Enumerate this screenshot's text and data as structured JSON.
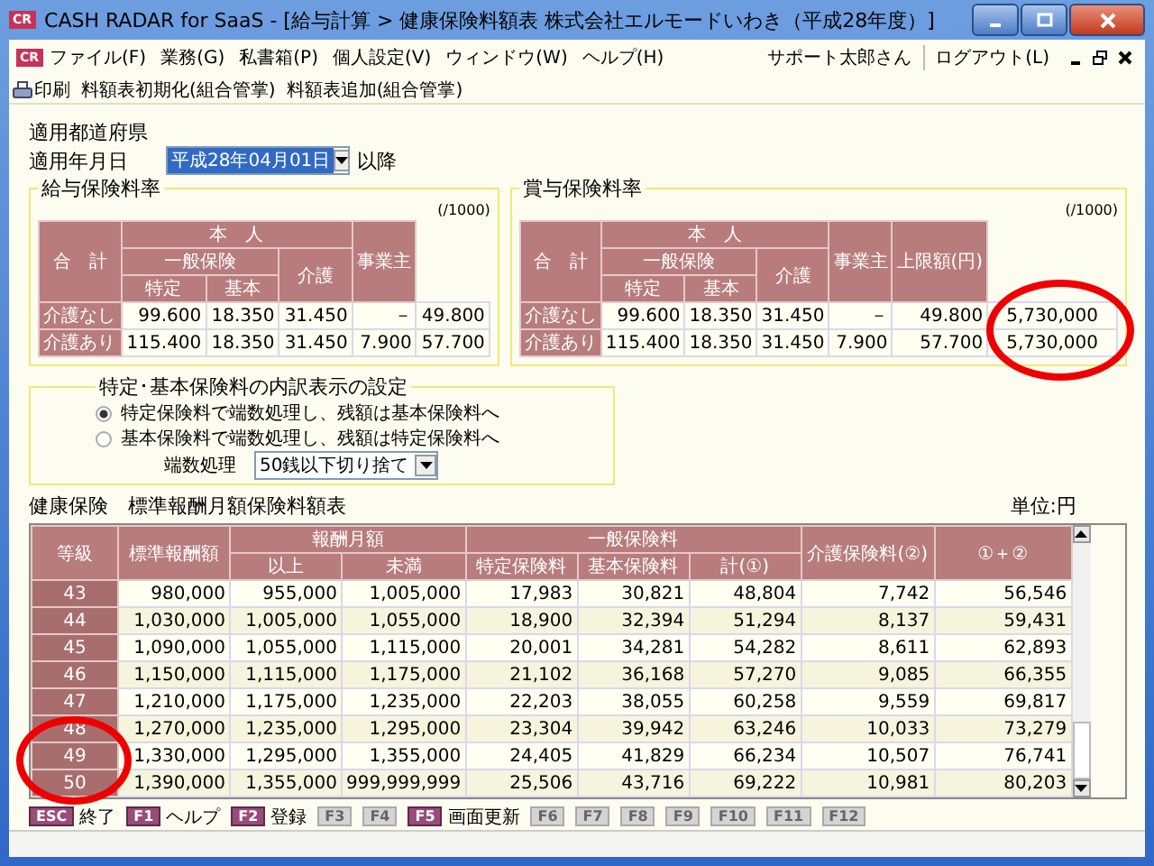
{
  "window": {
    "title": "CASH RADAR for SaaS - [給与計算 > 健康保険料額表 株式会社エルモードいわき（平成28年度）]",
    "app_badge": "CR"
  },
  "menu": {
    "badge": "CR",
    "items": [
      "ファイル(F)",
      "業務(G)",
      "私書箱(P)",
      "個人設定(V)",
      "ウィンドウ(W)",
      "ヘルプ(H)"
    ],
    "user": "サポート太郎さん",
    "logout": "ログアウト(L)"
  },
  "toolbar": {
    "items": [
      "印刷",
      "料額表初期化(組合管掌)",
      "料額表追加(組合管掌)"
    ]
  },
  "prefecture_label": "適用都道府県",
  "date": {
    "label": "適用年月日",
    "value": "平成28年04月01日",
    "suffix": "以降",
    "focused": true
  },
  "salary_rates": {
    "title": "給与保険料率",
    "unit": "(/1000)",
    "headers": {
      "total": "合　計",
      "person": "本　人",
      "general": "一般保険",
      "specific": "特定",
      "basic": "基本",
      "care": "介護",
      "employer": "事業主"
    },
    "rows": [
      {
        "label": "介護なし",
        "values": [
          "99.600",
          "18.350",
          "31.450",
          "－",
          "49.800"
        ]
      },
      {
        "label": "介護あり",
        "values": [
          "115.400",
          "18.350",
          "31.450",
          "7.900",
          "57.700"
        ]
      }
    ]
  },
  "bonus_rates": {
    "title": "賞与保険料率",
    "unit": "(/1000)",
    "headers": {
      "total": "合　計",
      "person": "本　人",
      "general": "一般保険",
      "specific": "特定",
      "basic": "基本",
      "care": "介護",
      "employer": "事業主",
      "limit": "上限額(円)"
    },
    "limit_circled": true,
    "rows": [
      {
        "label": "介護なし",
        "values": [
          "99.600",
          "18.350",
          "31.450",
          "－",
          "49.800",
          "5,730,000"
        ]
      },
      {
        "label": "介護あり",
        "values": [
          "115.400",
          "18.350",
          "31.450",
          "7.900",
          "57.700",
          "5,730,000"
        ]
      }
    ]
  },
  "breakdown": {
    "title": "特定･基本保険料の内訳表示の設定",
    "options": [
      {
        "label": "特定保険料で端数処理し、残額は基本保険料へ",
        "selected": true
      },
      {
        "label": "基本保険料で端数処理し、残額は特定保険料へ",
        "selected": false
      }
    ],
    "rounding_label": "端数処理",
    "rounding_value": "50銭以下切り捨て"
  },
  "table": {
    "title": "健康保険　標準報酬月額保険料額表",
    "unit": "単位:円",
    "grades_circled": true,
    "headers": {
      "grade": "等級",
      "standard": "標準報酬額",
      "monthly": "報酬月額",
      "from": "以上",
      "to": "未満",
      "general": "一般保険料",
      "specific": "特定保険料",
      "basic": "基本保険料",
      "sum": "計(①)",
      "care": "介護保険料(②)",
      "total": "①＋②"
    },
    "rows": [
      {
        "grade": "43",
        "values": [
          "980,000",
          "955,000",
          "1,005,000",
          "17,983",
          "30,821",
          "48,804",
          "7,742",
          "56,546"
        ]
      },
      {
        "grade": "44",
        "values": [
          "1,030,000",
          "1,005,000",
          "1,055,000",
          "18,900",
          "32,394",
          "51,294",
          "8,137",
          "59,431"
        ]
      },
      {
        "grade": "45",
        "values": [
          "1,090,000",
          "1,055,000",
          "1,115,000",
          "20,001",
          "34,281",
          "54,282",
          "8,611",
          "62,893"
        ]
      },
      {
        "grade": "46",
        "values": [
          "1,150,000",
          "1,115,000",
          "1,175,000",
          "21,102",
          "36,168",
          "57,270",
          "9,085",
          "66,355"
        ]
      },
      {
        "grade": "47",
        "values": [
          "1,210,000",
          "1,175,000",
          "1,235,000",
          "22,203",
          "38,055",
          "60,258",
          "9,559",
          "69,817"
        ]
      },
      {
        "grade": "48",
        "values": [
          "1,270,000",
          "1,235,000",
          "1,295,000",
          "23,304",
          "39,942",
          "63,246",
          "10,033",
          "73,279"
        ]
      },
      {
        "grade": "49",
        "values": [
          "1,330,000",
          "1,295,000",
          "1,355,000",
          "24,405",
          "41,829",
          "66,234",
          "10,507",
          "76,741"
        ]
      },
      {
        "grade": "50",
        "values": [
          "1,390,000",
          "1,355,000",
          "999,999,999",
          "25,506",
          "43,716",
          "69,222",
          "10,981",
          "80,203"
        ]
      }
    ]
  },
  "function_keys": [
    {
      "key": "ESC",
      "label": "終了",
      "disabled": false
    },
    {
      "key": "F1",
      "label": "ヘルプ",
      "disabled": false
    },
    {
      "key": "F2",
      "label": "登録",
      "disabled": false
    },
    {
      "key": "F3",
      "disabled": true
    },
    {
      "key": "F4",
      "disabled": true
    },
    {
      "key": "F5",
      "label": "画面更新",
      "disabled": false
    },
    {
      "key": "F6",
      "disabled": true
    },
    {
      "key": "F7",
      "disabled": true
    },
    {
      "key": "F8",
      "disabled": true
    },
    {
      "key": "F9",
      "disabled": true
    },
    {
      "key": "F10",
      "disabled": true
    },
    {
      "key": "F11",
      "disabled": true
    },
    {
      "key": "F12",
      "disabled": true
    }
  ]
}
